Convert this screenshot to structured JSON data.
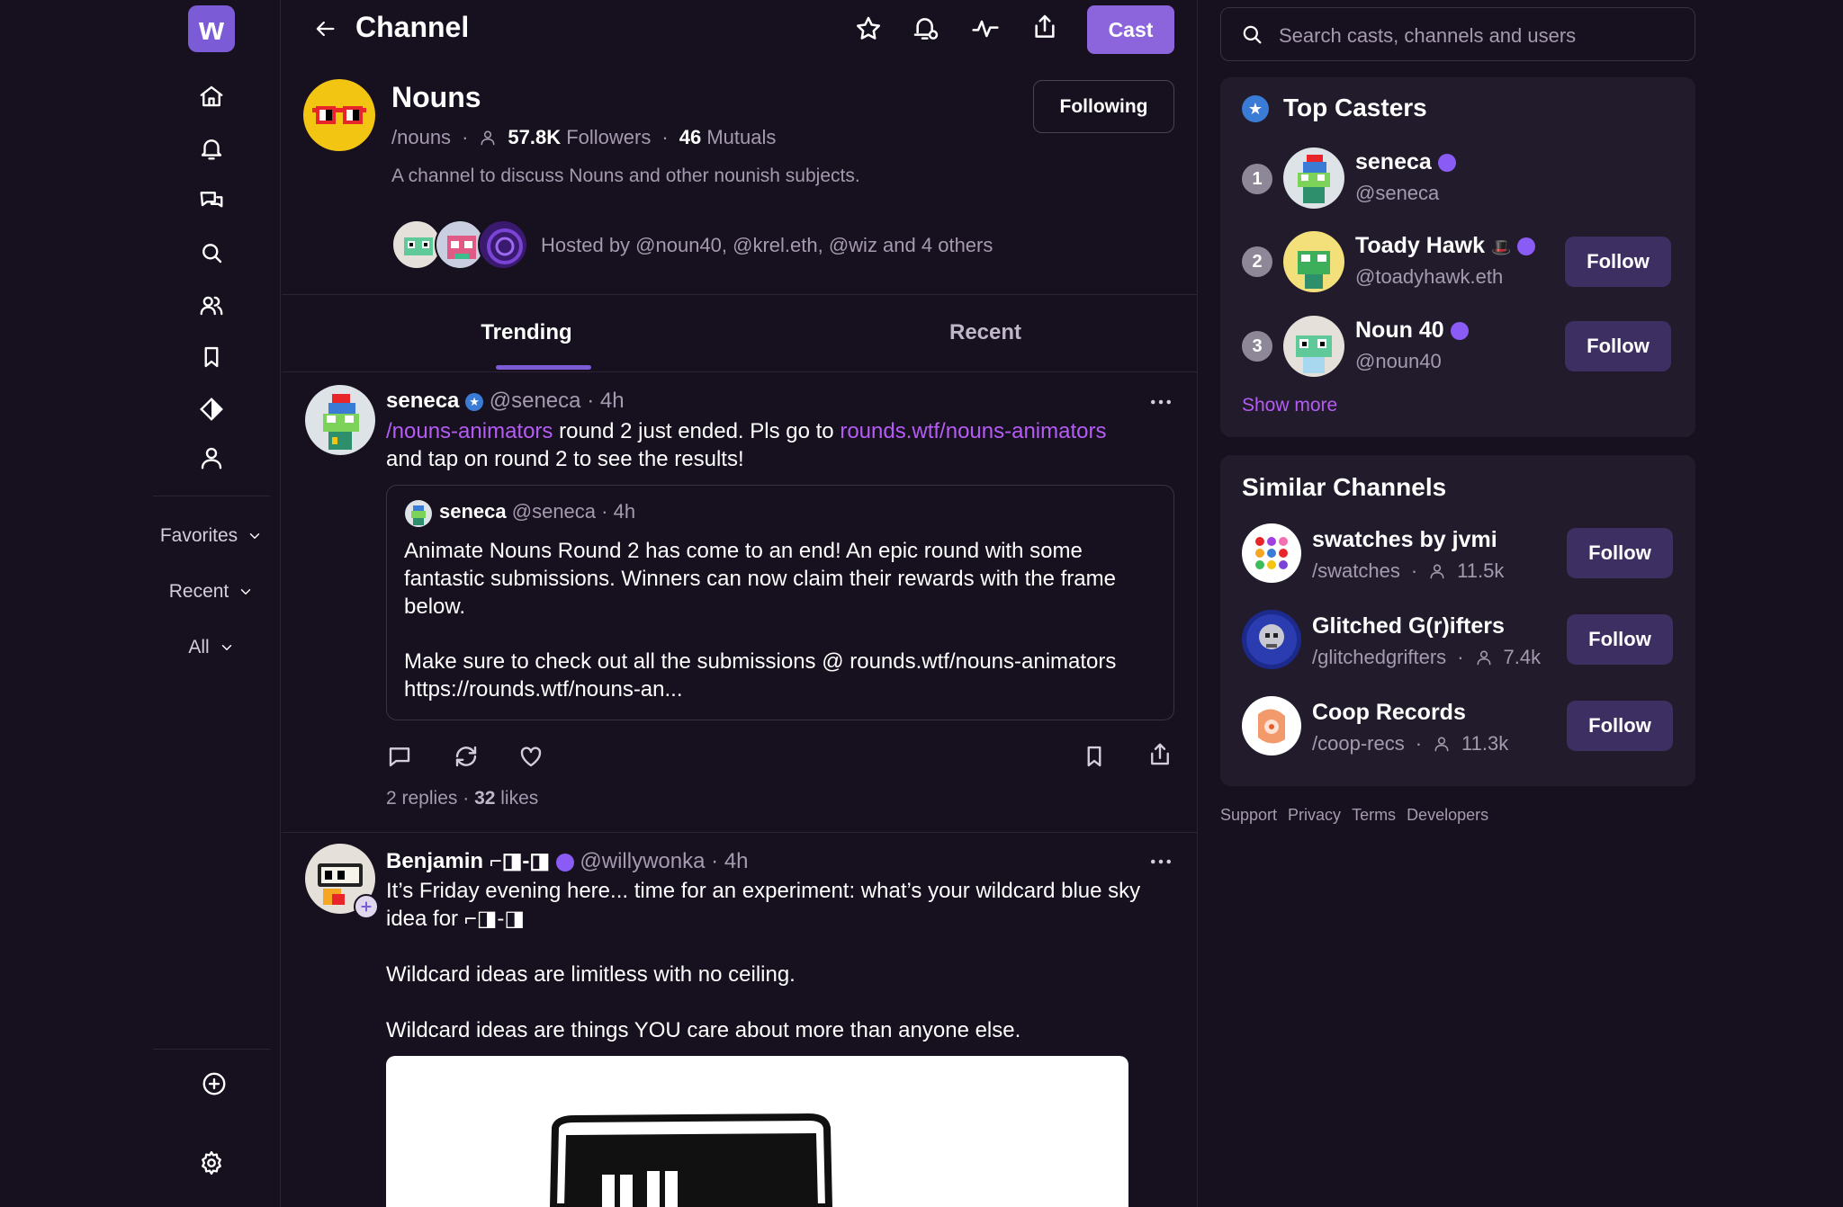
{
  "app": {
    "logo_letter": "w",
    "accent": "#7c5cd6"
  },
  "nav": {
    "icons": [
      "home-icon",
      "bell-icon",
      "chat-icon",
      "search-icon",
      "users-icon",
      "bookmark-icon",
      "diamond-icon",
      "user-icon"
    ],
    "favorites": "Favorites",
    "recent": "Recent",
    "all": "All"
  },
  "header": {
    "title": "Channel",
    "cast_label": "Cast"
  },
  "channel": {
    "name": "Nouns",
    "handle": "/nouns",
    "followers_count": "57.8K",
    "followers_label": "Followers",
    "mutuals_count": "46",
    "mutuals_label": "Mutuals",
    "description": "A channel to discuss Nouns and other nounish subjects.",
    "hosted_by": "Hosted by @noun40, @krel.eth, @wiz and 4 others",
    "following_label": "Following"
  },
  "tabs": [
    {
      "label": "Trending",
      "active": true
    },
    {
      "label": "Recent",
      "active": false
    }
  ],
  "posts": [
    {
      "author": "seneca",
      "handle": "@seneca",
      "time": "· 4h",
      "link1": "/nouns-animators",
      "text1": " round 2 just ended. Pls go to ",
      "link2": "rounds.wtf/nouns-animators",
      "text2": "and tap on round 2 to see the results!",
      "quote": {
        "author": "seneca",
        "handle": "@seneca",
        "time": "· 4h",
        "para1": "Animate Nouns Round 2 has come to an end! An epic round with some fantastic submissions. Winners can now claim their rewards with the frame below.",
        "para2": "Make sure to check out all the submissions @ rounds.wtf/nouns-animators https://rounds.wtf/nouns-an..."
      },
      "replies": "2 replies",
      "likes_count": "32",
      "likes_label": "likes"
    },
    {
      "author": "Benjamin ⌐◨-◨",
      "handle": "@willywonka",
      "time": "· 4h",
      "line1": "It’s Friday evening here... time for an experiment: what’s your wildcard blue sky idea for ⌐◨-◨",
      "line2": "Wildcard ideas are limitless with no ceiling.",
      "line3": "Wildcard ideas are things YOU care about more than anyone else."
    }
  ],
  "search": {
    "placeholder": "Search casts, channels and users"
  },
  "top_casters": {
    "title": "Top Casters",
    "items": [
      {
        "rank": "1",
        "name": "seneca",
        "handle": "@seneca"
      },
      {
        "rank": "2",
        "name": "Toady Hawk",
        "handle": "@toadyhawk.eth",
        "follow": "Follow"
      },
      {
        "rank": "3",
        "name": "Noun 40",
        "handle": "@noun40",
        "follow": "Follow"
      }
    ],
    "show_more": "Show more"
  },
  "similar_channels": {
    "title": "Similar Channels",
    "items": [
      {
        "name": "swatches by jvmi",
        "handle": "/swatches",
        "count": "11.5k",
        "follow": "Follow"
      },
      {
        "name": "Glitched G(r)ifters",
        "handle": "/glitchedgrifters",
        "count": "7.4k",
        "follow": "Follow"
      },
      {
        "name": "Coop Records",
        "handle": "/coop-recs",
        "count": "11.3k",
        "follow": "Follow"
      }
    ]
  },
  "footer": {
    "links": [
      "Support",
      "Privacy",
      "Terms",
      "Developers"
    ]
  }
}
